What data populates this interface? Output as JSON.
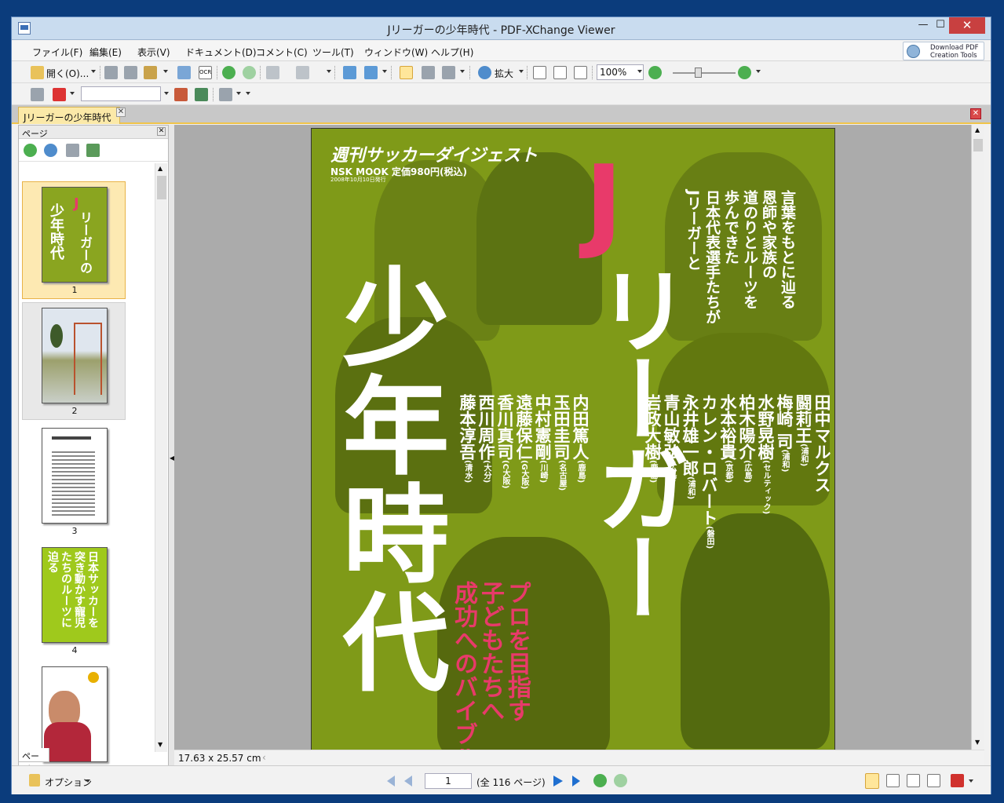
{
  "window": {
    "title": "Jリーガーの少年時代 - PDF-XChange Viewer"
  },
  "menu": [
    "ファイル(F)",
    "編集(E)",
    "表示(V)",
    "ドキュメント(D)",
    "コメント(C)",
    "ツール(T)",
    "ウィンドウ(W)",
    "ヘルプ(H)"
  ],
  "download": {
    "line1": "Download PDF",
    "line2": "Creation Tools"
  },
  "toolbar": {
    "open_label": "開く(O)...",
    "zoom_in_label": "拡大",
    "zoom_value": "100%"
  },
  "tab": {
    "label": "Jリーガーの少年時代"
  },
  "sidebar": {
    "header": "ページ",
    "tab_label": "ページ",
    "pages": [
      "1",
      "2",
      "3",
      "4"
    ]
  },
  "status": {
    "page_size": "17.63 x 25.57 cm"
  },
  "nav": {
    "options_label": "オプション",
    "current_page": "1",
    "page_total": "(全 116 ページ)"
  },
  "cover": {
    "magazine_brand": "週刊サッカーダイジェスト",
    "mook": "NSK MOOK",
    "price": "定価980円(税込)",
    "date": "2008年10月10日発行",
    "title_j": "J",
    "title_rest": "リーガー",
    "title_big": "少年時代",
    "catch_1": "Jリーガーと",
    "catch_2": "日本代表選手たちが",
    "catch_3": "歩んできた",
    "catch_4": "道のりとルーツを",
    "catch_5": "恩師や家族の",
    "catch_6": "言葉をもとに辿る",
    "pink_1": "プロを目指す",
    "pink_2": "子どもたちへ",
    "pink_3": "成功へのバイブル",
    "names": [
      {
        "name": "田中マルクス",
        "team": ""
      },
      {
        "name": "闘莉王",
        "team": "(浦和)"
      },
      {
        "name": "梅崎 司",
        "team": "(浦和)"
      },
      {
        "name": "水野晃樹",
        "team": "(セルティック)"
      },
      {
        "name": "柏木陽介",
        "team": "(広島)"
      },
      {
        "name": "水本裕貴",
        "team": "(京都)"
      },
      {
        "name": "カレン・ロバート",
        "team": "(磐田)"
      },
      {
        "name": "永井雄一郎",
        "team": "(浦和)"
      },
      {
        "name": "青山敏弘",
        "team": "(広島)"
      },
      {
        "name": "岩政大樹",
        "team": "(鹿島)"
      },
      {
        "name": "内田篤人",
        "team": "(鹿島)"
      },
      {
        "name": "玉田圭司",
        "team": "(名古屋)"
      },
      {
        "name": "中村憲剛",
        "team": "(川崎)"
      },
      {
        "name": "遠藤保仁",
        "team": "(G大阪)"
      },
      {
        "name": "香川真司",
        "team": "(C大阪)"
      },
      {
        "name": "西川周作",
        "team": "(大分)"
      },
      {
        "name": "藤本淳吾",
        "team": "(清水)"
      }
    ]
  },
  "thumb4_text": "日本サッカーを突き動かす寵児たちのルーツに迫る"
}
